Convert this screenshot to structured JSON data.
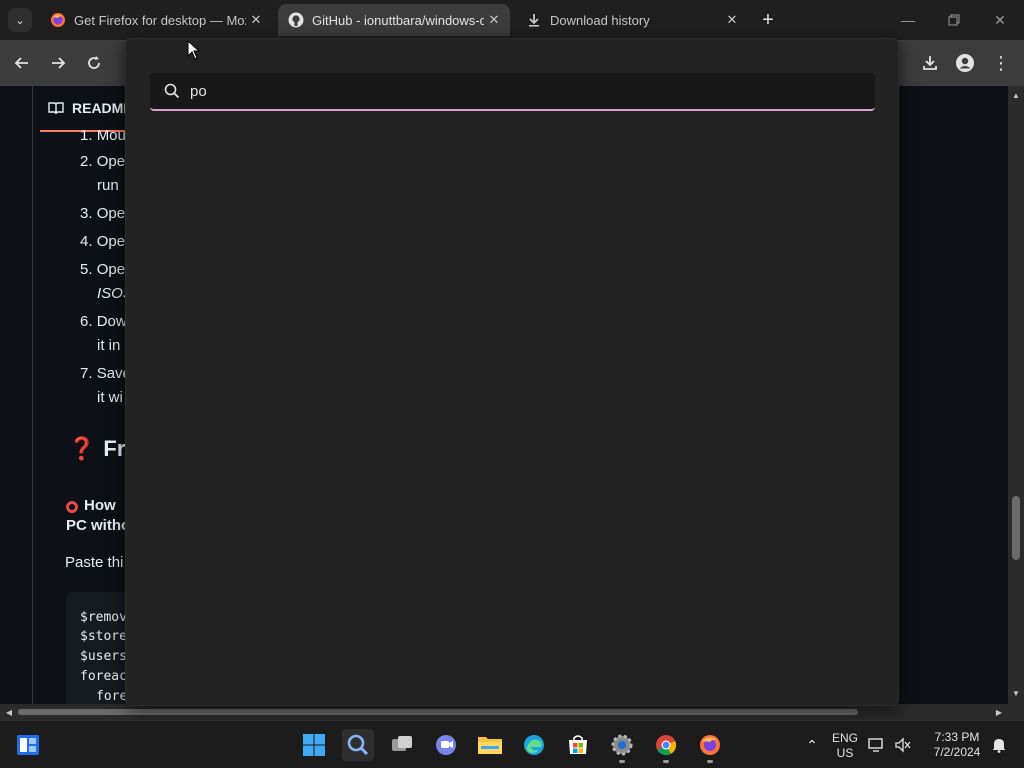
{
  "browser": {
    "tabs": [
      {
        "title": "Get Firefox for desktop — Mozilla",
        "active": false
      },
      {
        "title": "GitHub - ionuttbara/windows-defender-remover",
        "active": true
      },
      {
        "title": "Download history",
        "active": false
      }
    ],
    "close_glyph": "✕",
    "new_tab_glyph": "+"
  },
  "readme": {
    "tab_label": "README",
    "list_items": [
      {
        "num": "1.",
        "text": "Mou"
      },
      {
        "num": "2.",
        "text": "Ope"
      },
      {
        "num": "",
        "text": "run"
      },
      {
        "num": "3.",
        "text": "Ope"
      },
      {
        "num": "4.",
        "text": "Ope"
      },
      {
        "num": "5.",
        "text": "Ope"
      },
      {
        "num": "",
        "text": "ISOS"
      },
      {
        "num": "6.",
        "text": "Dow"
      },
      {
        "num": "",
        "text": "it in"
      },
      {
        "num": "7.",
        "text": "Save"
      },
      {
        "num": "",
        "text": "it wi"
      }
    ],
    "faq_heading": "Fr",
    "faq_question_line1": "How",
    "faq_question_line2": "PC witho",
    "paste_text": "Paste thi",
    "code_lines": [
      "$remov",
      "$store",
      "$users",
      "foreac",
      "  fore"
    ]
  },
  "search": {
    "value": "po",
    "placeholder": ""
  },
  "taskbar": {
    "lang_line1": "ENG",
    "lang_line2": "US",
    "time": "7:33 PM",
    "date": "7/2/2024"
  },
  "colors": {
    "accent_underline": "#d9a4c8",
    "readme_underline": "#f78166",
    "overlay_bg": "#232323"
  }
}
